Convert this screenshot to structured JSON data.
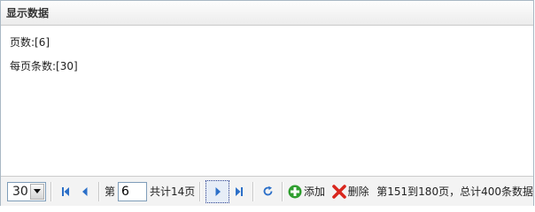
{
  "panel": {
    "title": "显示数据"
  },
  "body": {
    "page_line": "页数:[6]",
    "rows_line": "每页条数:[30]"
  },
  "pager": {
    "page_size": {
      "selected": "30"
    },
    "page_prefix": "第",
    "current_page": "6",
    "total_label": "共计14页",
    "add_label": "添加",
    "delete_label": "删除",
    "status": "第151到180页，总计400条数据"
  },
  "icons": {
    "first": "first-page-icon",
    "prev": "prev-page-icon",
    "next": "next-page-icon",
    "last": "last-page-icon",
    "refresh": "refresh-icon",
    "add": "add-icon",
    "delete": "delete-icon",
    "dropdown": "chevron-down-icon"
  },
  "colors": {
    "nav_blue": "#2b6fc8",
    "add_green": "#2f9e2f",
    "delete_red": "#d9271e"
  }
}
